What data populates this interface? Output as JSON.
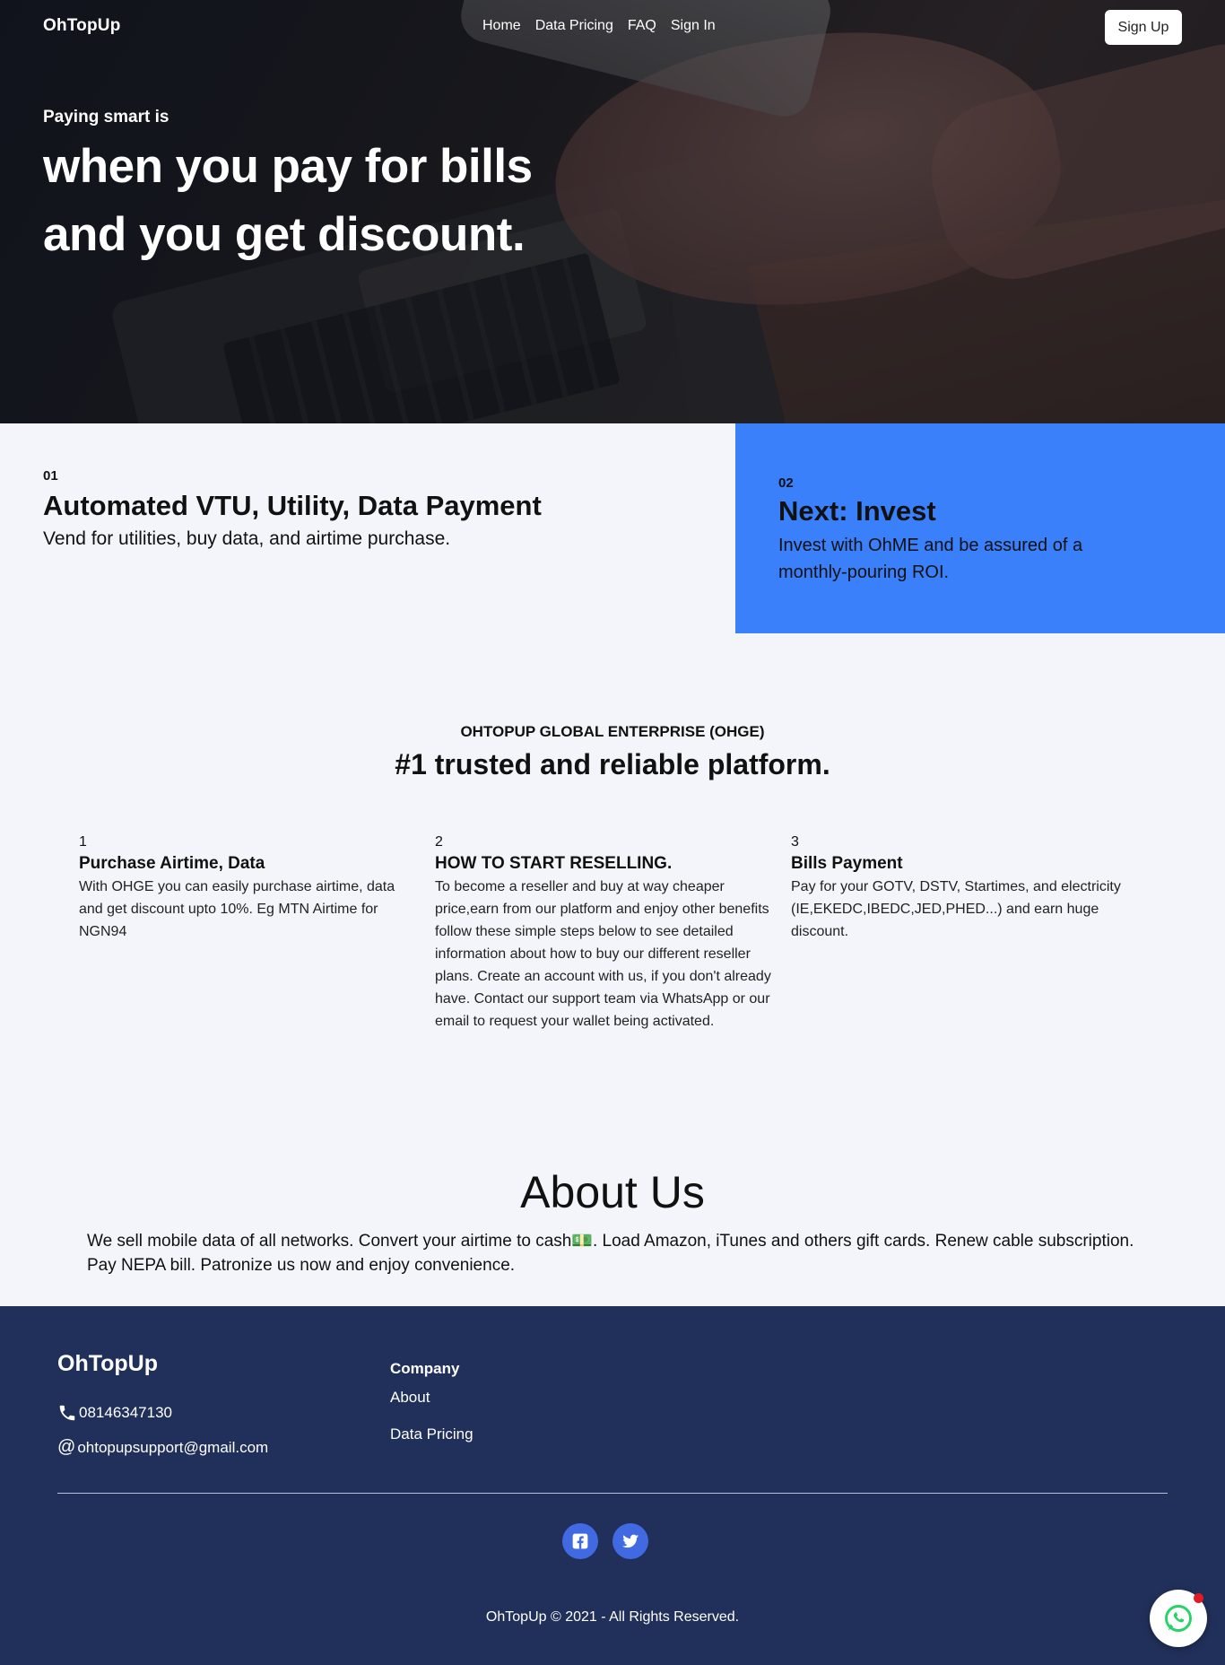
{
  "nav": {
    "brand": "OhTopUp",
    "links": [
      "Home",
      "Data Pricing",
      "FAQ",
      "Sign In"
    ],
    "signup_label": "Sign Up"
  },
  "hero": {
    "kicker": "Paying smart is",
    "title": "when you pay for bills and you get discount."
  },
  "features": {
    "left": {
      "number": "01",
      "title": "Automated VTU, Utility, Data Payment",
      "description": "Vend for utilities, buy data, and airtime purchase."
    },
    "right": {
      "number": "02",
      "title": "Next: Invest",
      "description": "Invest with OhME and be assured of a monthly-pouring ROI.",
      "background": "#3b80fb"
    }
  },
  "trust": {
    "kicker": "OHTOPUP GLOBAL ENTERPRISE (OHGE)",
    "title": "#1 trusted and reliable platform.",
    "columns": [
      {
        "number": "1",
        "title": "Purchase Airtime, Data",
        "description": "With OHGE you can easily purchase airtime, data and get discount upto 10%. Eg MTN Airtime for NGN94"
      },
      {
        "number": "2",
        "title": "HOW TO START RESELLING.",
        "description": "To become a reseller and buy at way cheaper price,earn from our platform and enjoy other benefits follow these simple steps below to see detailed information about how to buy our different reseller plans. Create an account with us, if you don't already have. Contact our support team via WhatsApp or our email to request your wallet being activated."
      },
      {
        "number": "3",
        "title": "Bills Payment",
        "description": "Pay for your GOTV, DSTV, Startimes, and electricity (IE,EKEDC,IBEDC,JED,PHED...) and earn huge discount."
      }
    ]
  },
  "about": {
    "title": "About Us",
    "text": "We sell mobile data of all networks. Convert your airtime to cash💵. Load Amazon, iTunes and others gift cards. Renew cable subscription. Pay NEPA bill. Patronize us now and enjoy convenience."
  },
  "footer": {
    "brand": "OhTopUp",
    "phone": "08146347130",
    "email": "ohtopupsupport@gmail.com",
    "company_heading": "Company",
    "links": [
      "About",
      "Data Pricing"
    ],
    "social_icons": [
      "facebook-icon",
      "twitter-icon"
    ],
    "copyright": "OhTopUp © 2021 - All Rights Reserved.",
    "background": "#21305a",
    "social_color": "#4169e1"
  },
  "whatsapp_icon": "whatsapp-icon"
}
